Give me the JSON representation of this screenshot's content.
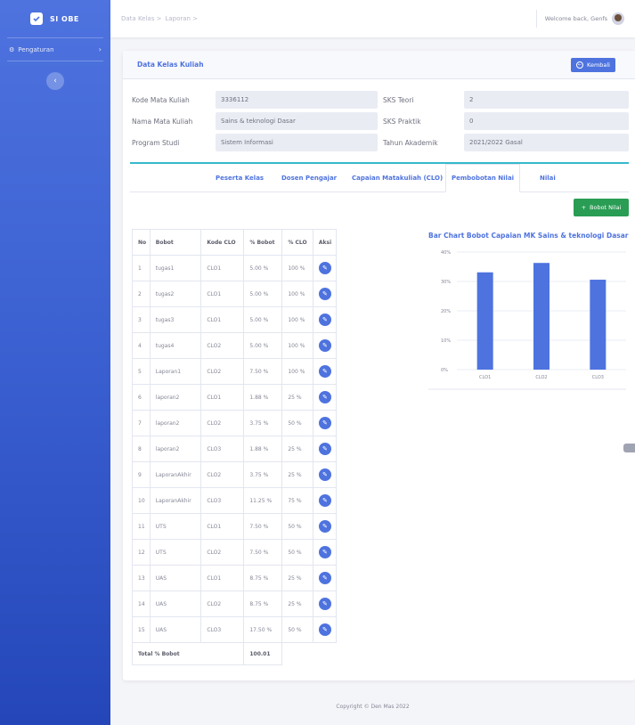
{
  "brand": {
    "name": "SI OBE"
  },
  "sidebar": {
    "items": [
      {
        "label": "Pengaturan"
      }
    ]
  },
  "breadcrumb": [
    "Data Kelas >",
    "Laporan >"
  ],
  "topbar": {
    "welcome": "Welcome back, Genfs"
  },
  "card": {
    "title": "Data Kelas Kuliah",
    "back_label": "Kembali"
  },
  "info": {
    "kode_label": "Kode Mata Kuliah",
    "kode_value": "3336112",
    "nama_label": "Nama Mata Kuliah",
    "nama_value": "Sains & teknologi Dasar",
    "prodi_label": "Program Studi",
    "prodi_value": "Sistem Informasi",
    "teori_label": "SKS Teori",
    "teori_value": "2",
    "praktik_label": "SKS Praktik",
    "praktik_value": "0",
    "tahun_label": "Tahun Akademik",
    "tahun_value": "2021/2022 Gasal"
  },
  "tabs": [
    "Peserta Kelas",
    "Dosen Pengajar",
    "Capaian Matakuliah (CLO)",
    "Pembobotan Nilai",
    "Nilai"
  ],
  "add_button": "Bobot Nilai",
  "table": {
    "headers": [
      "No",
      "Bobot",
      "Kode CLO",
      "% Bobot",
      "% CLO",
      "Aksi"
    ],
    "rows": [
      [
        "1",
        "tugas1",
        "CLO1",
        "5.00 %",
        "100 %"
      ],
      [
        "2",
        "tugas2",
        "CLO1",
        "5.00 %",
        "100 %"
      ],
      [
        "3",
        "tugas3",
        "CLO1",
        "5.00 %",
        "100 %"
      ],
      [
        "4",
        "tugas4",
        "CLO2",
        "5.00 %",
        "100 %"
      ],
      [
        "5",
        "Laporan1",
        "CLO2",
        "7.50 %",
        "100 %"
      ],
      [
        "6",
        "laporan2",
        "CLO1",
        "1.88 %",
        "25 %"
      ],
      [
        "7",
        "laporan2",
        "CLO2",
        "3.75 %",
        "50 %"
      ],
      [
        "8",
        "laporan2",
        "CLO3",
        "1.88 %",
        "25 %"
      ],
      [
        "9",
        "LaporanAkhir",
        "CLO2",
        "3.75 %",
        "25 %"
      ],
      [
        "10",
        "LaporanAkhir",
        "CLO3",
        "11.25 %",
        "75 %"
      ],
      [
        "11",
        "UTS",
        "CLO1",
        "7.50 %",
        "50 %"
      ],
      [
        "12",
        "UTS",
        "CLO2",
        "7.50 %",
        "50 %"
      ],
      [
        "13",
        "UAS",
        "CLO1",
        "8.75 %",
        "25 %"
      ],
      [
        "14",
        "UAS",
        "CLO2",
        "8.75 %",
        "25 %"
      ],
      [
        "15",
        "UAS",
        "CLO3",
        "17.50 %",
        "50 %"
      ]
    ],
    "total_label": "Total % Bobot",
    "total_value": "100.01"
  },
  "chart_data": {
    "type": "bar",
    "title": "Bar Chart Bobot Capaian MK Sains & teknologi Dasar",
    "categories": [
      "CLO1",
      "CLO2",
      "CLO3"
    ],
    "values": [
      33.1,
      36.3,
      30.6
    ],
    "ylim": [
      0,
      40
    ],
    "yticks": [
      "0%",
      "10%",
      "20%",
      "30%",
      "40%"
    ],
    "grid": true,
    "bar_color": "#4e73df"
  },
  "footer": "Copyright © Den Mas 2022",
  "colors": {
    "primary": "#4e73df",
    "success": "#2a9d55",
    "info": "#36b9cc"
  }
}
